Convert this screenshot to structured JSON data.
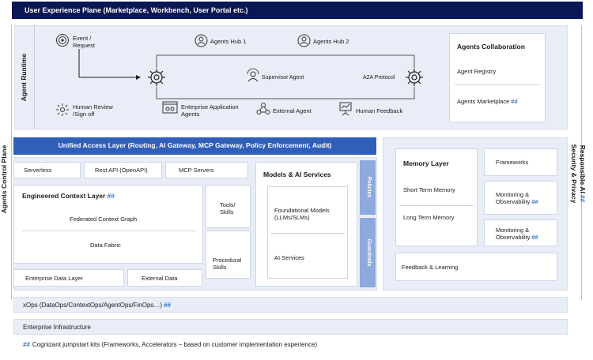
{
  "colors": {
    "navy": "#0b1654",
    "blue": "#2f5fb8",
    "light_blue": "#8eaadd",
    "panel": "#e8edf7",
    "hash": "#2f6fd0"
  },
  "top_bar": "User Experience Plane (Marketplace, Workbench, User Portal etc.)",
  "left_label": "Agents Control Plane",
  "right_label_1": "Responsible AI",
  "right_label_2": "Security & Privacy",
  "right_label_hash": "##",
  "hash_mark": "##",
  "runtime": {
    "label": "Agent Runtime",
    "event": "Event /",
    "event_2": "Request",
    "hub1": "Agents Hub 1",
    "hub2": "Agents Hub 2",
    "supervisor": "Supervisor Agent",
    "a2a": "A2A Protocol",
    "human_review": "Human Review",
    "human_review_2": "/Sign off",
    "enterprise_app": "Enterprise Application",
    "enterprise_app_2": "Agents",
    "external": "External Agent",
    "human_feedback": "Human Feedback",
    "icons": [
      "event-icon",
      "hub-icon",
      "gear-icon",
      "supervisor-icon",
      "human-review-icon",
      "app-agents-icon",
      "external-agent-icon",
      "feedback-icon"
    ]
  },
  "collaboration": {
    "title": "Agents Collaboration",
    "registry": "Agent Registry",
    "marketplace": "Agents Marketplace"
  },
  "unified_access": "Unified Access Layer (Routing, AI Gateway, MCP Gateway, Policy Enforcement, Audit)",
  "access_items": [
    "Serverless",
    "Rest API (OpenAPI)",
    "MCP Servers"
  ],
  "context": {
    "title": "Engineered Context Layer",
    "graph": "Federated Context Graph",
    "fabric": "Data Fabric",
    "tools": "Tools/",
    "tools_2": "Skills",
    "procedural": "Procedural",
    "procedural_2": "Skills",
    "enterprise_data": "Enterprise Data Layer",
    "external_data": "External Data"
  },
  "models": {
    "title": "Models & AI Services",
    "foundational": "Foundational Models",
    "foundational_2": "(LLMs/SLMs)",
    "ai_services": "AI Services",
    "policies": "Policies",
    "guardrails": "Guardrails"
  },
  "memory": {
    "title": "Memory Layer",
    "short": "Short Term Memory",
    "long": "Long Term Memory",
    "frameworks": "Frameworks",
    "monitoring": "Monitoring &",
    "observability": "Observability",
    "feedback": "Feedback & Learning"
  },
  "xops": "xOps (DataOps/ContextOps/AgentOps/FinOps…)",
  "infra": "Enterprise Infrastructure",
  "footnote": "Cognizant jumpstart kits (Frameworks, Accelerators – based on customer implementation experience)"
}
